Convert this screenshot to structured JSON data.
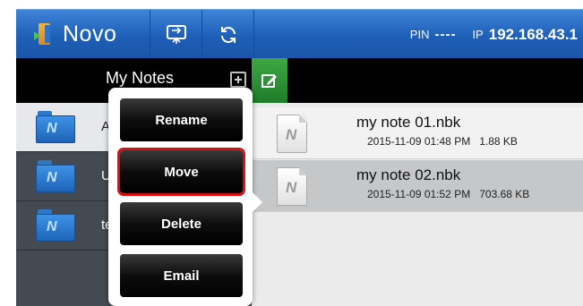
{
  "header": {
    "app_title": "Novo",
    "pin_label": "PIN",
    "pin_value": "----",
    "ip_label": "IP",
    "ip_value": "192.168.43.1",
    "accent_color": "#1f5fb8"
  },
  "left_panel": {
    "title": "My Notes",
    "folders": [
      {
        "label": "A",
        "selected": true
      },
      {
        "label": "U",
        "selected": false
      },
      {
        "label": "te",
        "selected": false
      }
    ]
  },
  "notes": [
    {
      "name": "my note 01.nbk",
      "date": "2015-11-09 01:48 PM",
      "size": "1.88 KB",
      "selected": false
    },
    {
      "name": "my note 02.nbk",
      "date": "2015-11-09 01:52 PM",
      "size": "703.68 KB",
      "selected": true
    }
  ],
  "context_menu": {
    "items": [
      "Rename",
      "Move",
      "Delete",
      "Email"
    ],
    "highlighted": "Move",
    "highlight_color": "#d90f12"
  },
  "icons": {
    "logo": "novo-logo-icon",
    "present": "screen-present-icon",
    "refresh": "refresh-icon",
    "add": "add-folder-icon",
    "edit": "edit-note-icon",
    "folder": "folder-icon",
    "note": "note-file-icon"
  }
}
